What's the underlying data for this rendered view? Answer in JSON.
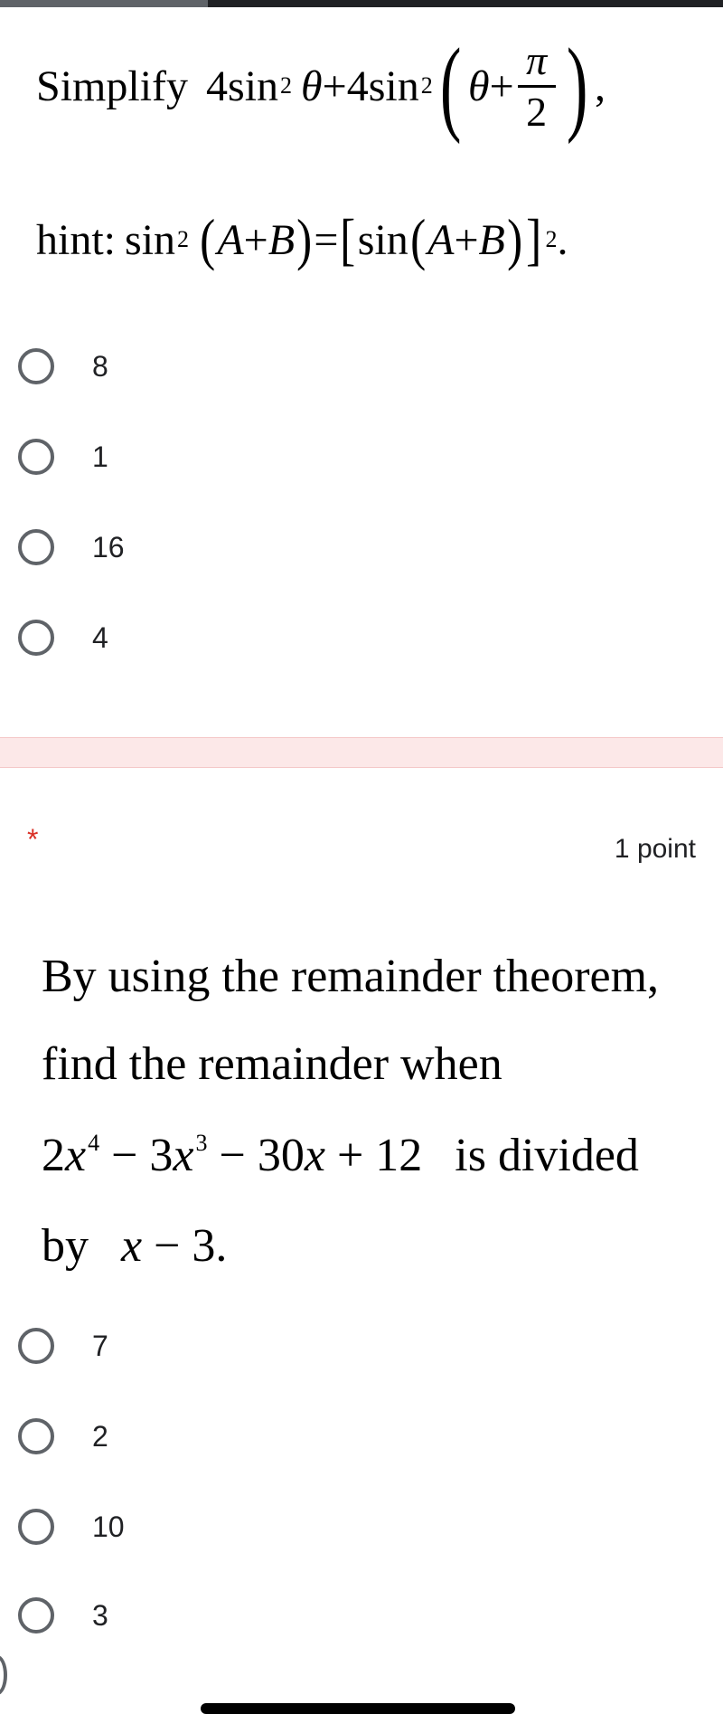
{
  "question1": {
    "prompt_word": "Simplify",
    "expr": {
      "coef1": "4",
      "fn": "sin",
      "pow": "2",
      "theta": "θ",
      "plus": "+",
      "coef2": "4",
      "pi": "π",
      "den": "2",
      "comma": ","
    },
    "hint_label": "hint:",
    "hint": {
      "fn": "sin",
      "pow": "2",
      "A": "A",
      "B": "B",
      "plus": "+",
      "eq": "=",
      "period": "."
    },
    "options": [
      "8",
      "1",
      "16",
      "4"
    ]
  },
  "question2": {
    "required_mark": "*",
    "points": "1 point",
    "line1": "By using the remainder theorem,",
    "line2": "find the remainder when",
    "poly": {
      "t1": "2",
      "x": "x",
      "p4": "4",
      "minus": "−",
      "t2": "3",
      "p3": "3",
      "t3": "30",
      "plus": "+",
      "t4": "12"
    },
    "line3_tail": "is divided",
    "by_word": "by",
    "divisor": {
      "x": "x",
      "minus": "−",
      "num": "3",
      "period": "."
    },
    "options": [
      "7",
      "2",
      "10",
      "3"
    ]
  },
  "colors": {
    "radio_border": "#5f6368",
    "required": "#d93025",
    "divider_band": "#fce8e8"
  }
}
